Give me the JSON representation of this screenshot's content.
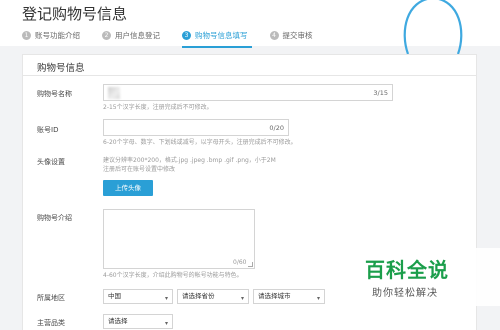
{
  "header": {
    "title": "登记购物号信息",
    "steps": [
      {
        "num": "1",
        "label": "账号功能介绍"
      },
      {
        "num": "2",
        "label": "用户信息登记"
      },
      {
        "num": "3",
        "label": "购物号信息填写"
      },
      {
        "num": "4",
        "label": "提交审核"
      }
    ],
    "active_step": 3
  },
  "form": {
    "section_title": "购物号信息",
    "name": {
      "label": "购物号名称",
      "counter": "3/15",
      "hint": "2-15个汉字长度，注册完成后不可修改。"
    },
    "account_id": {
      "label": "账号ID",
      "counter": "0/20",
      "hint": "6-20个字母、数字、下划线或减号，以字母开头，注册完成后不可修改。"
    },
    "avatar": {
      "label": "头像设置",
      "hint_line1": "建议分辨率200*200，格式.jpg .jpeg .bmp .gif .png，小于2M",
      "hint_line2": "注册后可在账号设置中修改",
      "upload_button": "上传头像"
    },
    "intro": {
      "label": "购物号介绍",
      "counter": "0/60",
      "hint": "4-60个汉字长度，介绍此购物号的帐号功能与特色。"
    },
    "region": {
      "label": "所属地区",
      "country": "中国",
      "province": "请选择省份",
      "city": "请选择城市"
    },
    "category": {
      "label": "主营品类",
      "value": "请选择"
    }
  },
  "watermark": {
    "title": "百科全说",
    "subtitle": "助你轻松解决"
  },
  "colors": {
    "accent": "#2a9fd6",
    "watermark_green": "#1b9e4b"
  }
}
